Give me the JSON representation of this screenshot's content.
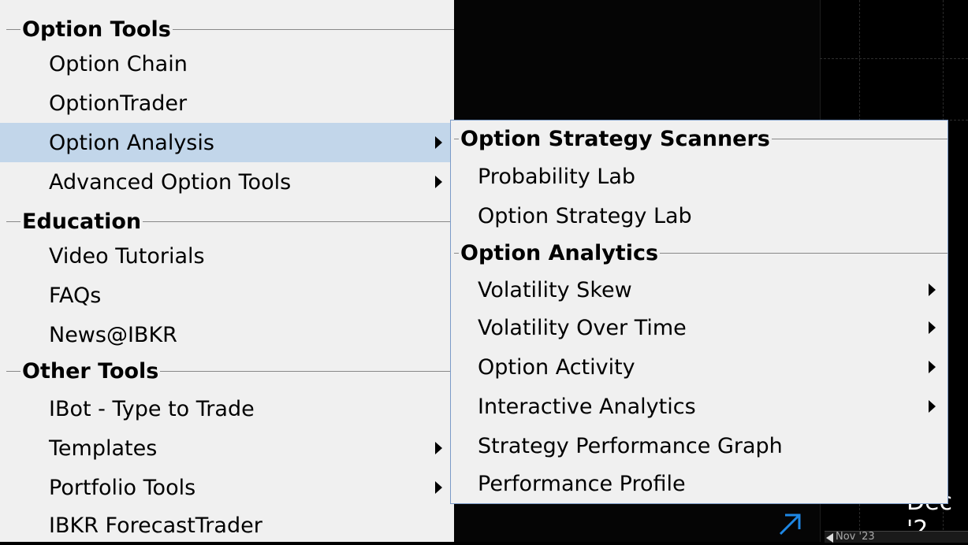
{
  "menu": {
    "sections": [
      {
        "title": "Option Tools",
        "items": [
          {
            "label": "Option Chain",
            "submenu": false
          },
          {
            "label": "OptionTrader",
            "submenu": false
          },
          {
            "label": "Option Analysis",
            "submenu": true,
            "highlighted": true
          },
          {
            "label": "Advanced Option Tools",
            "submenu": true
          }
        ]
      },
      {
        "title": "Education",
        "items": [
          {
            "label": "Video Tutorials",
            "submenu": false
          },
          {
            "label": "FAQs",
            "submenu": false
          },
          {
            "label": "News@IBKR",
            "submenu": false
          }
        ]
      },
      {
        "title": "Other Tools",
        "items": [
          {
            "label": "IBot - Type to Trade",
            "submenu": false
          },
          {
            "label": "Templates",
            "submenu": true
          },
          {
            "label": "Portfolio Tools",
            "submenu": true
          },
          {
            "label": "IBKR ForecastTrader",
            "submenu": false
          }
        ]
      }
    ]
  },
  "submenu": {
    "sections": [
      {
        "title": "Option Strategy Scanners",
        "items": [
          {
            "label": "Probability Lab",
            "submenu": false
          },
          {
            "label": "Option Strategy Lab",
            "submenu": false
          }
        ]
      },
      {
        "title": "Option Analytics",
        "items": [
          {
            "label": "Volatility Skew",
            "submenu": true
          },
          {
            "label": "Volatility Over Time",
            "submenu": true
          },
          {
            "label": "Option Activity",
            "submenu": true
          },
          {
            "label": "Interactive Analytics",
            "submenu": true
          },
          {
            "label": "Strategy Performance Graph",
            "submenu": false
          },
          {
            "label": "Performance Profile",
            "submenu": false
          }
        ]
      }
    ]
  },
  "chart": {
    "date_label": "Dec '2",
    "scroll_label": "Nov '23"
  },
  "colors": {
    "menu_bg": "#f0f0f0",
    "highlight": "#c2d6ea",
    "submenu_border": "#7b9bc8",
    "accent_icon": "#1e88e5"
  }
}
